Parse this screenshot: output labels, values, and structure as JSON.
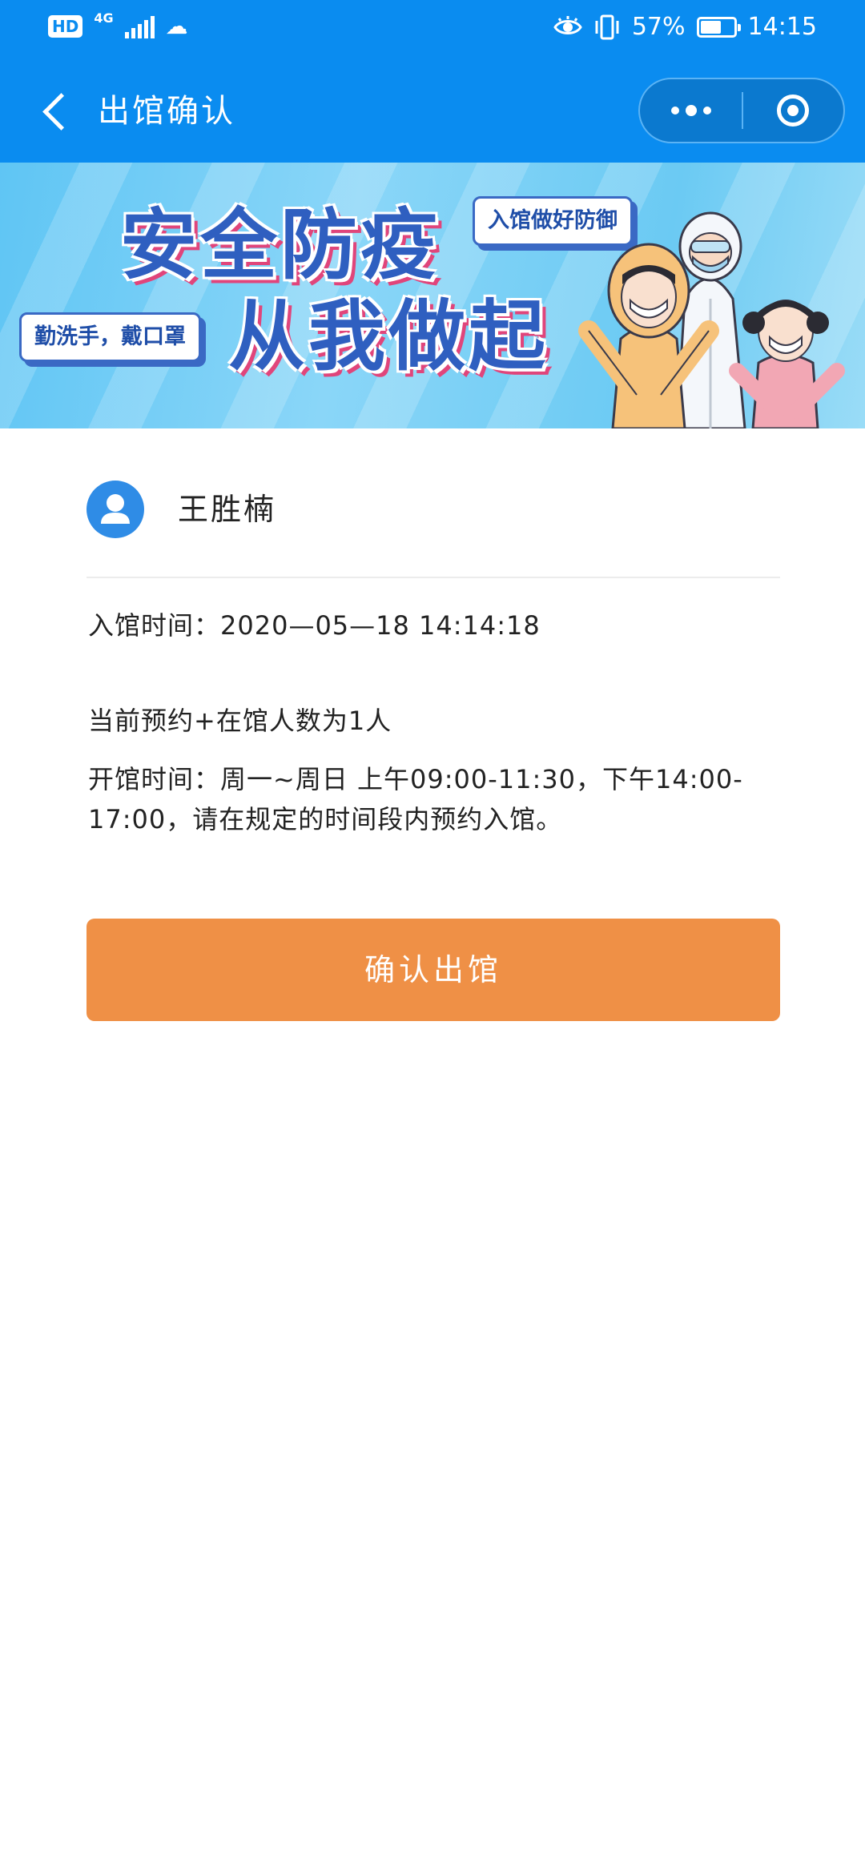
{
  "status_bar": {
    "hd_label": "HD",
    "network_type": "4G",
    "battery_percent": "57%",
    "battery_level": 0.57,
    "time": "14:15",
    "icons": [
      "signal-icon",
      "cloud-icon",
      "eye-comfort-icon",
      "vibrate-icon",
      "battery-icon"
    ]
  },
  "header": {
    "title": "出馆确认",
    "back_icon": "chevron-left-icon",
    "more_icon": "more-dots-icon",
    "close_icon": "target-circle-icon",
    "background": "#0a8cf0"
  },
  "banner": {
    "headline_line1": "安全防疫",
    "headline_line2": "从我做起",
    "tag_top": "入馆做好防御",
    "tag_bottom": "勤洗手，戴口罩"
  },
  "user": {
    "name": "王胜楠",
    "avatar_icon": "user-avatar-icon"
  },
  "info": {
    "entry_time": "入馆时间：2020—05—18  14:14:18",
    "count_text": "当前预约+在馆人数为1人",
    "hours_text": "开馆时间：周一~周日  上午09:00-11:30，下午14:00-17:00，请在规定的时间段内预约入馆。"
  },
  "actions": {
    "confirm_label": "确认出馆",
    "confirm_color": "#ef9046"
  }
}
